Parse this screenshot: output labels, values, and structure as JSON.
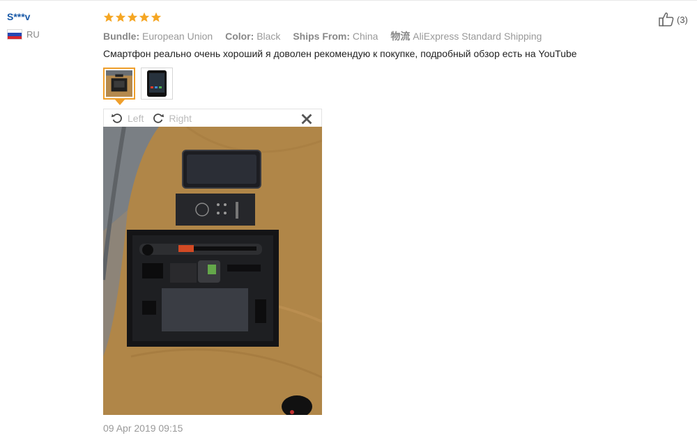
{
  "review": {
    "user": {
      "name": "S***v",
      "country_code": "RU",
      "flag_colors": [
        "#ffffff",
        "#2548b4",
        "#d7262d"
      ]
    },
    "rating": {
      "stars": 5,
      "max": 5,
      "color": "#f5a623"
    },
    "attributes": [
      {
        "key": "Bundle:",
        "value": "European Union"
      },
      {
        "key": "Color:",
        "value": "Black"
      },
      {
        "key": "Ships From:",
        "value": "China"
      },
      {
        "key": "物流",
        "value": "AliExpress Standard Shipping"
      }
    ],
    "text": "Смартфон реально очень хороший я доволен рекомендую к покупке, подробный обзор есть на YouTube",
    "images": {
      "count": 2,
      "selected_index": 0
    },
    "viewer": {
      "rotate_left_label": "Left",
      "rotate_right_label": "Right",
      "close_icon": "close-icon"
    },
    "date": "09 Apr 2019 09:15",
    "helpful": {
      "icon": "thumbs-up-icon",
      "count_label": "(3)"
    }
  },
  "colors": {
    "username": "#1a5aa8",
    "accent": "#ef9f2b",
    "muted": "#999999"
  }
}
